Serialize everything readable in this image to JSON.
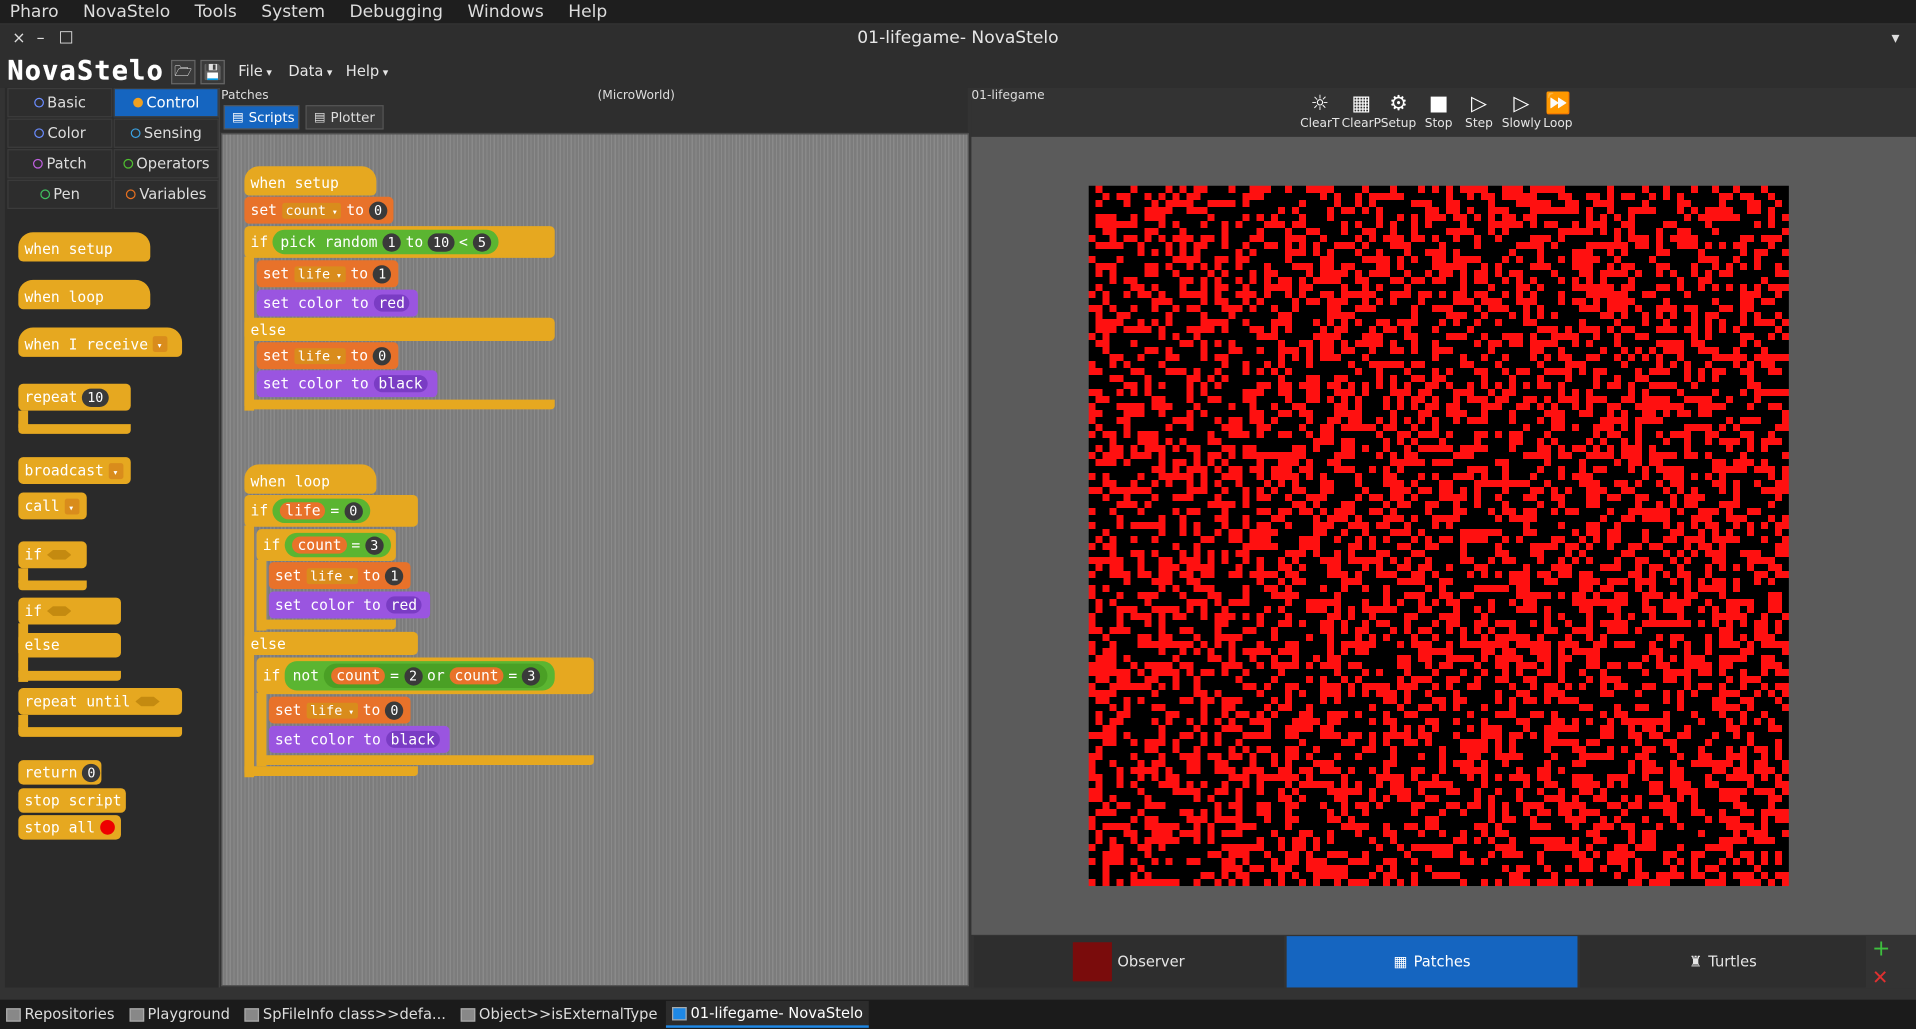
{
  "menubar": [
    "Pharo",
    "NovaStelo",
    "Tools",
    "System",
    "Debugging",
    "Windows",
    "Help"
  ],
  "window": {
    "title": "01-lifegame- NovaStelo",
    "close": "×",
    "minimize": "–",
    "maximize": "□",
    "collapse": "▾"
  },
  "app": {
    "logo": "NovaStelo",
    "menus": [
      "File",
      "Data",
      "Help"
    ],
    "open_icon": "folder-icon",
    "save_icon": "floppy-icon"
  },
  "palette": {
    "categories": [
      {
        "label": "Basic",
        "color": "#6a8cff"
      },
      {
        "label": "Control",
        "color": "#f0a020"
      },
      {
        "label": "Color",
        "color": "#6a8cff"
      },
      {
        "label": "Sensing",
        "color": "#3aa0e0"
      },
      {
        "label": "Patch",
        "color": "#c060e0"
      },
      {
        "label": "Operators",
        "color": "#50c030"
      },
      {
        "label": "Pen",
        "color": "#40c060"
      },
      {
        "label": "Variables",
        "color": "#e87020"
      }
    ],
    "blocks": {
      "when_setup": "when setup",
      "when_loop": "when loop",
      "when_receive": "when I receive",
      "repeat": "repeat",
      "repeat_n": "10",
      "broadcast": "broadcast",
      "call": "call",
      "if": "if",
      "else": "else",
      "repeat_until": "repeat until",
      "return": "return",
      "return_n": "0",
      "stop_script": "stop script",
      "stop_all": "stop all"
    }
  },
  "scripts_header": {
    "target": "Patches",
    "tabs": [
      "Scripts",
      "Plotter"
    ],
    "microworld": "(MicroWorld)"
  },
  "script1": {
    "hat": "when setup",
    "set": "set",
    "to": "to",
    "count": "count",
    "zero": "0",
    "if": "if",
    "pick": "pick random",
    "one": "1",
    "ten": "10",
    "lt": "<",
    "five": "5",
    "life": "life",
    "set_color": "set color to",
    "red": "red",
    "else": "else",
    "black": "black"
  },
  "script2": {
    "hat": "when loop",
    "if": "if",
    "life": "life",
    "eq": "=",
    "zero": "0",
    "count": "count",
    "three": "3",
    "set": "set",
    "to": "to",
    "one": "1",
    "set_color": "set color to",
    "red": "red",
    "else": "else",
    "not": "not",
    "two": "2",
    "or": "or",
    "black": "black"
  },
  "stage": {
    "name": "01-lifegame",
    "controls": [
      {
        "label": "ClearT",
        "icon": "bug-icon",
        "glyph": "☼"
      },
      {
        "label": "ClearP",
        "icon": "grid-icon",
        "glyph": "▦"
      },
      {
        "label": "Setup",
        "icon": "gear-icon",
        "glyph": "⚙"
      },
      {
        "label": "Stop",
        "icon": "stop-icon",
        "glyph": "■"
      },
      {
        "label": "Step",
        "icon": "step-icon",
        "glyph": "▷"
      },
      {
        "label": "Slowly",
        "icon": "play-icon",
        "glyph": "▷"
      },
      {
        "label": "Loop",
        "icon": "loop-icon",
        "glyph": "⏩"
      }
    ],
    "live_color": "#ff1010",
    "dead_color": "#000000",
    "tabs": [
      {
        "label": "Observer"
      },
      {
        "label": "Patches"
      },
      {
        "label": "Turtles"
      }
    ],
    "add": "+",
    "remove": "✕"
  },
  "taskbar": [
    "Repositories",
    "Playground",
    "SpFileInfo class>>defa...",
    "Object>>isExternalType",
    "01-lifegame- NovaStelo"
  ]
}
